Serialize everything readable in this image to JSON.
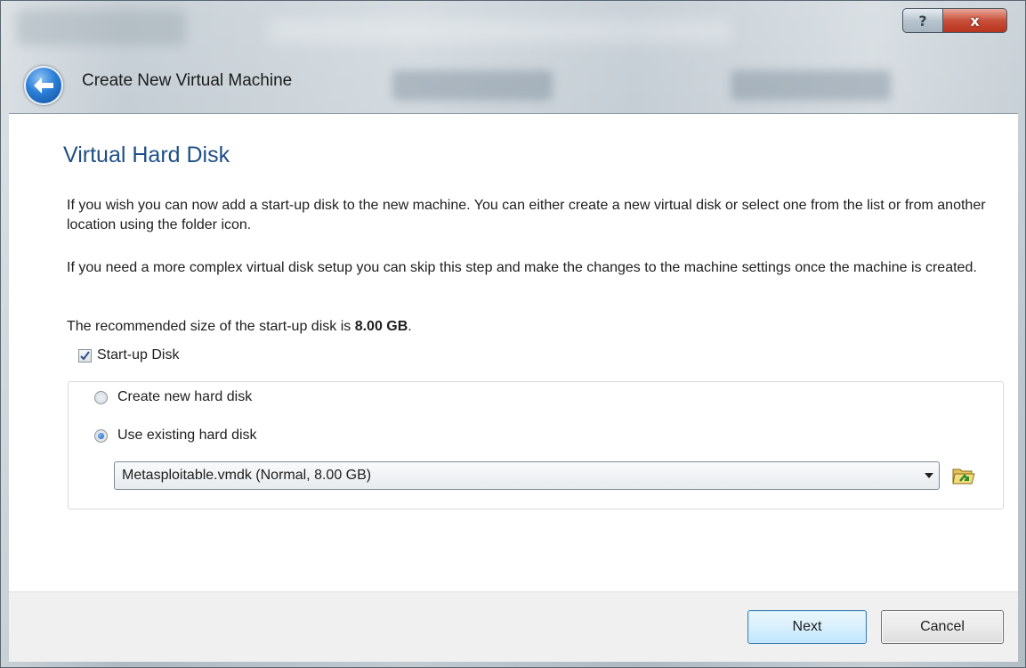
{
  "window": {
    "title": "Create New Virtual Machine",
    "help_glyph": "?",
    "close_glyph": "x",
    "back_icon": "back-arrow-icon"
  },
  "page": {
    "heading": "Virtual Hard Disk",
    "paragraph1": "If you wish you can now add a start-up disk to the new machine. You can either create a new virtual disk or select one from the list or from another location using the folder icon.",
    "paragraph2": "If you need a more complex virtual disk setup you can skip this step and make the changes to the machine settings once the machine is created.",
    "recommended_prefix": "The recommended size of the start-up disk is ",
    "recommended_size": "8.00 GB",
    "recommended_suffix": "."
  },
  "startup_disk": {
    "label": "Start-up Disk",
    "checked": true,
    "options": [
      {
        "label": "Create new hard disk",
        "selected": false
      },
      {
        "label": "Use existing hard disk",
        "selected": true
      }
    ],
    "selected_disk": "Metasploitable.vmdk (Normal, 8.00 GB)",
    "folder_icon": "folder-icon"
  },
  "buttons": {
    "next": "Next",
    "cancel": "Cancel"
  },
  "colors": {
    "heading": "#1f4f86",
    "accent": "#2a7ed6"
  }
}
